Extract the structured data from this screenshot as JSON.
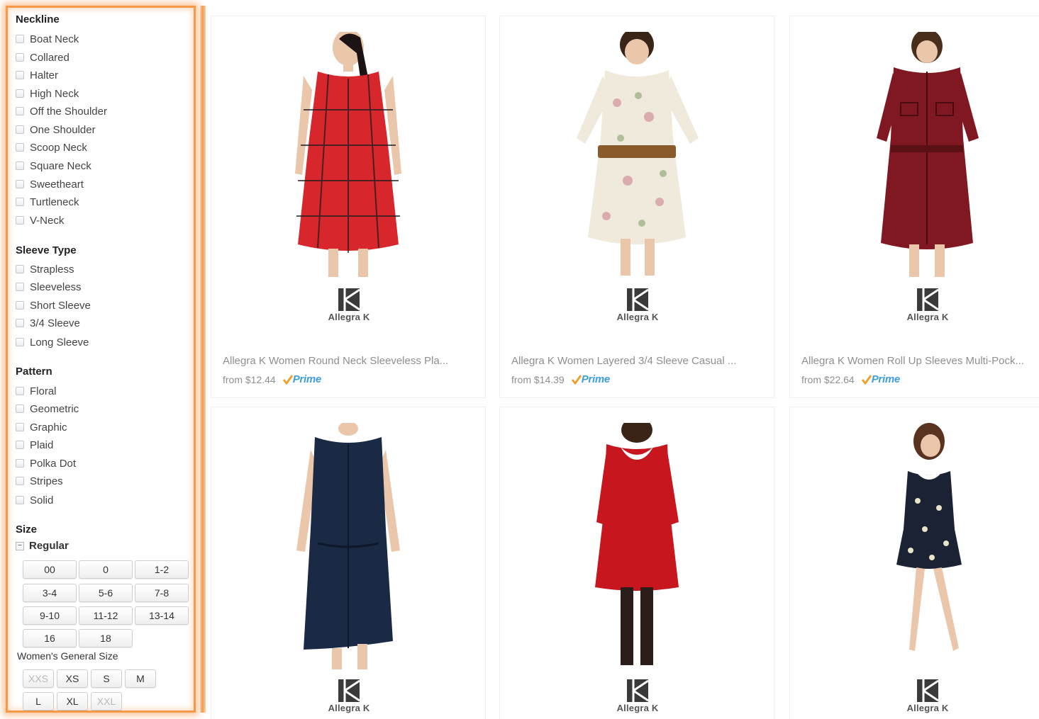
{
  "sidebar": {
    "neckline": {
      "title": "Neckline",
      "items": [
        "Boat Neck",
        "Collared",
        "Halter",
        "High Neck",
        "Off the Shoulder",
        "One Shoulder",
        "Scoop Neck",
        "Square Neck",
        "Sweetheart",
        "Turtleneck",
        "V-Neck"
      ]
    },
    "sleeve": {
      "title": "Sleeve Type",
      "items": [
        "Strapless",
        "Sleeveless",
        "Short Sleeve",
        "3/4 Sleeve",
        "Long Sleeve"
      ]
    },
    "pattern": {
      "title": "Pattern",
      "items": [
        "Floral",
        "Geometric",
        "Graphic",
        "Plaid",
        "Polka Dot",
        "Stripes",
        "Solid"
      ]
    },
    "size": {
      "title": "Size",
      "regular_label": "Regular",
      "regular_sizes": [
        "00",
        "0",
        "1-2",
        "3-4",
        "5-6",
        "7-8",
        "9-10",
        "11-12",
        "13-14",
        "16",
        "18"
      ],
      "general_label": "Women's General Size",
      "general_sizes": [
        {
          "label": "XXS",
          "disabled": true
        },
        {
          "label": "XS",
          "disabled": false
        },
        {
          "label": "S",
          "disabled": false
        },
        {
          "label": "M",
          "disabled": false
        },
        {
          "label": "L",
          "disabled": false
        },
        {
          "label": "XL",
          "disabled": false
        },
        {
          "label": "XXL",
          "disabled": true
        }
      ]
    }
  },
  "products": [
    {
      "brand": "Allegra K",
      "title": "Allegra K Women Round Neck Sleeveless Pla...",
      "price": "from $12.44",
      "prime": "Prime",
      "dress_color": "#d8262d",
      "style": "plaid"
    },
    {
      "brand": "Allegra K",
      "title": "Allegra K Women Layered 3/4 Sleeve Casual ...",
      "price": "from $14.39",
      "prime": "Prime",
      "dress_color": "#efeadb",
      "style": "floral"
    },
    {
      "brand": "Allegra K",
      "title": "Allegra K Women Roll Up Sleeves Multi-Pock...",
      "price": "from $22.64",
      "prime": "Prime",
      "dress_color": "#7f1820",
      "style": "shirt"
    },
    {
      "brand": "Allegra K",
      "dress_color": "#1a2a44",
      "style": "shirt-navy"
    },
    {
      "brand": "Allegra K",
      "dress_color": "#c8161e",
      "style": "collar"
    },
    {
      "brand": "Allegra K",
      "dress_color": "#1b2233",
      "style": "print"
    }
  ]
}
